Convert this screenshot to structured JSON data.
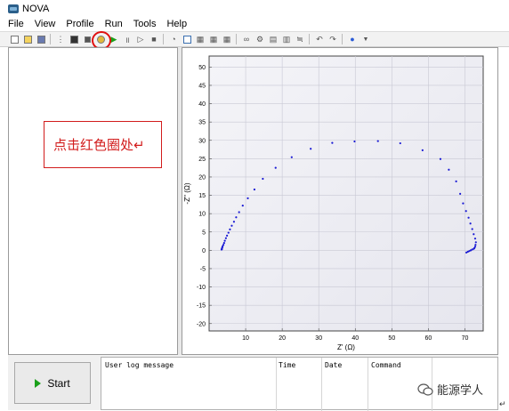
{
  "window": {
    "title": "NOVA"
  },
  "menu": [
    "File",
    "View",
    "Profile",
    "Run",
    "Tools",
    "Help"
  ],
  "toolbar": {
    "icons": [
      "new-icon",
      "open-icon",
      "save-icon",
      "print-icon",
      "tree-icon",
      "sequence-icon",
      "stop-record-icon",
      "highlighted-icon",
      "play-icon",
      "pause-icon",
      "step-icon",
      "abort-icon",
      "gauge-icon",
      "window1-icon",
      "window2-icon",
      "window3-icon",
      "window4-icon",
      "link-icon",
      "settings-icon",
      "chart1-icon",
      "chart2-icon",
      "chart3-icon",
      "undo-icon",
      "redo-icon",
      "dot-icon",
      "dropdown-icon"
    ]
  },
  "annotation": {
    "text": "点击红色圈处↵"
  },
  "start_button": {
    "label": "Start"
  },
  "log": {
    "columns": [
      "User log message",
      "Time",
      "Date",
      "Command"
    ]
  },
  "watermark": {
    "text": "能源学人"
  },
  "return_mark": "↵",
  "chart_data": {
    "type": "scatter",
    "xlabel": "Z' (Ω)",
    "ylabel": "-Z'' (Ω)",
    "xlim": [
      0,
      75
    ],
    "ylim": [
      -22,
      53
    ],
    "xticks": [
      10,
      20,
      30,
      40,
      50,
      60,
      70
    ],
    "yticks": [
      -20,
      -15,
      -10,
      -5,
      0,
      5,
      10,
      15,
      20,
      25,
      30,
      35,
      40,
      45,
      50
    ],
    "grid": true,
    "color": "#1a1ad4",
    "x": [
      72.4,
      72.0,
      71.6,
      71.2,
      70.8,
      70.4,
      72.6,
      72.8,
      72.9,
      73.0,
      72.8,
      72.4,
      72.0,
      71.5,
      71.0,
      70.3,
      69.5,
      68.7,
      67.6,
      65.6,
      63.3,
      58.4,
      52.3,
      46.2,
      39.8,
      33.7,
      27.8,
      22.6,
      18.2,
      14.7,
      12.4,
      10.6,
      9.2,
      8.2,
      7.4,
      6.8,
      6.2,
      5.7,
      5.3,
      4.9,
      4.6,
      4.3,
      4.1,
      3.9,
      3.7,
      3.6,
      3.5,
      3.5,
      3.4
    ],
    "y": [
      0.4,
      0.2,
      0.0,
      -0.2,
      -0.4,
      -0.6,
      0.6,
      1.0,
      1.5,
      2.2,
      3.2,
      4.4,
      5.8,
      7.3,
      8.9,
      10.7,
      12.8,
      15.4,
      18.8,
      22.0,
      24.9,
      27.3,
      29.2,
      29.8,
      29.7,
      29.3,
      27.7,
      25.4,
      22.5,
      19.5,
      16.6,
      14.2,
      12.2,
      10.4,
      9.0,
      7.8,
      6.7,
      5.7,
      4.8,
      4.0,
      3.3,
      2.6,
      2.0,
      1.5,
      1.1,
      0.8,
      0.5,
      0.3,
      0.2
    ]
  }
}
